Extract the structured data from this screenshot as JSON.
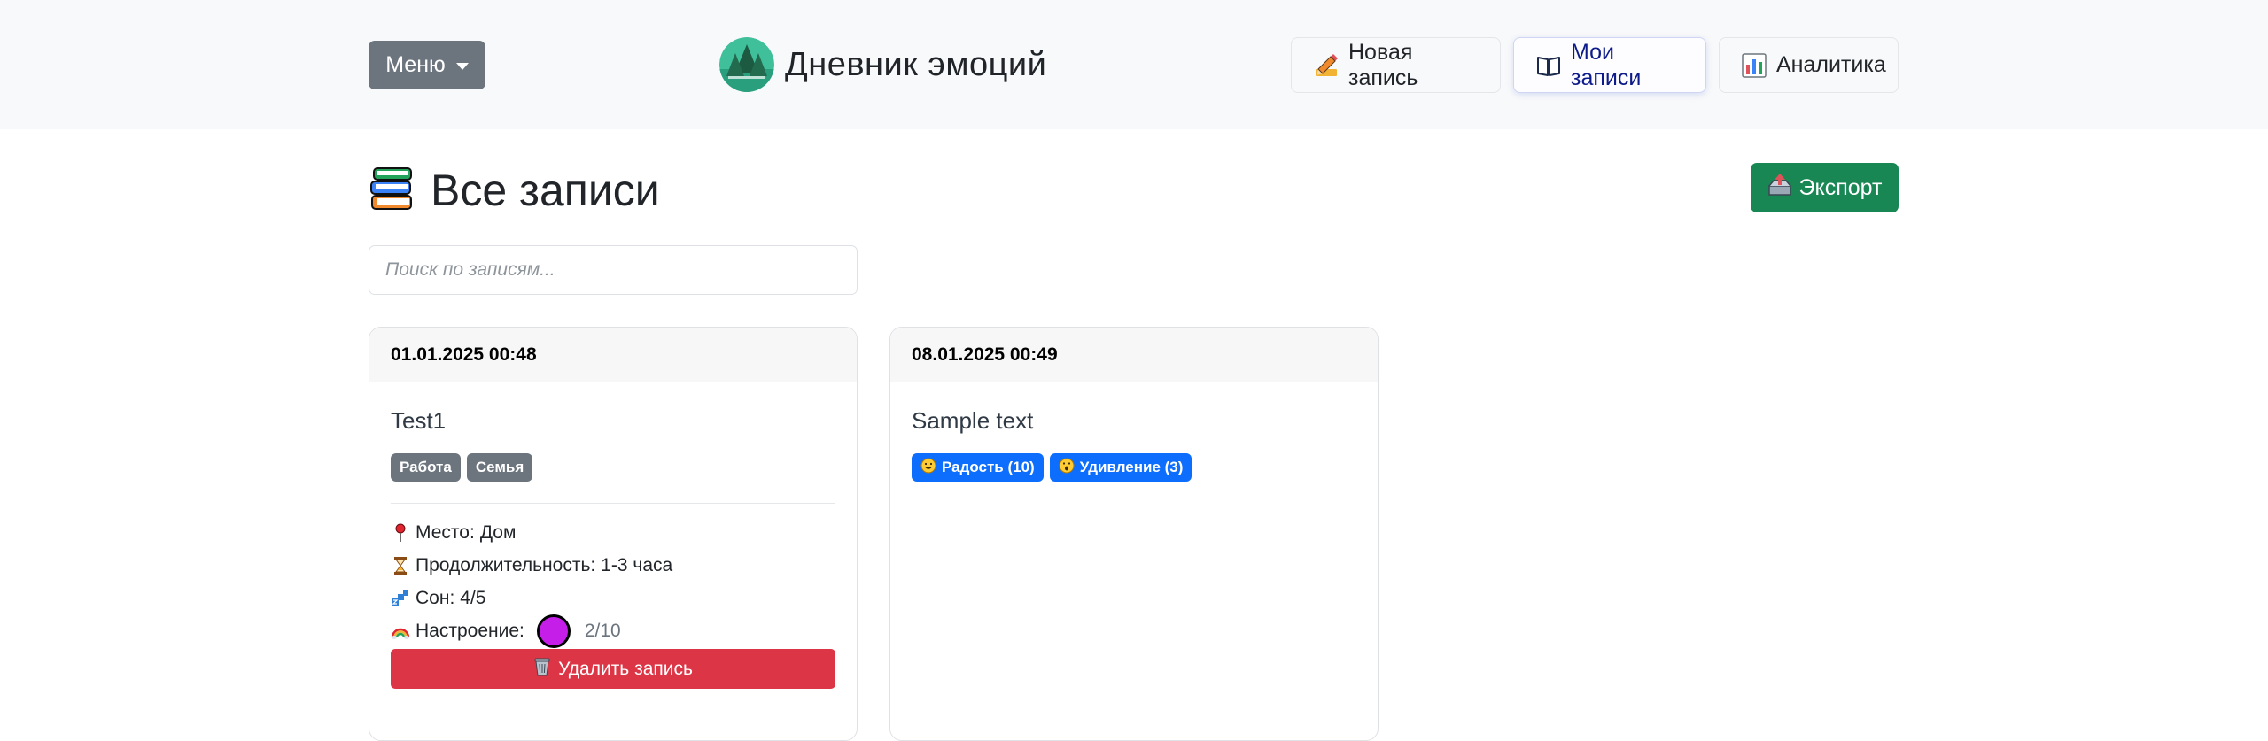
{
  "header": {
    "menu_label": "Меню",
    "brand_title": "Дневник эмоций",
    "nav": [
      {
        "label": "Новая запись",
        "icon": "pencil-icon"
      },
      {
        "label": "Мои записи",
        "icon": "book-icon",
        "active": true
      },
      {
        "label": "Аналитика",
        "icon": "bar-chart-icon"
      }
    ]
  },
  "page": {
    "title": "Все записи",
    "title_icon": "books-icon",
    "export_label": "Экспорт",
    "search_placeholder": "Поиск по записям..."
  },
  "entries": [
    {
      "datetime": "01.01.2025 00:48",
      "text": "Test1",
      "tags": [
        "Работа",
        "Семья"
      ],
      "details": {
        "place_label": "Место:",
        "place": "Дом",
        "duration_label": "Продолжительность:",
        "duration": "1-3 часа",
        "sleep_label": "Сон:",
        "sleep": "4/5",
        "mood_label": "Настроение:",
        "mood": "2/10",
        "mood_color": "#c51ee8"
      },
      "delete_label": "Удалить запись"
    },
    {
      "datetime": "08.01.2025 00:49",
      "text": "Sample text",
      "emotions": [
        {
          "label": "Радость (10)",
          "icon": "smile-emoji-icon"
        },
        {
          "label": "Удивление (3)",
          "icon": "surprised-emoji-icon"
        }
      ]
    }
  ],
  "colors": {
    "header_bg": "#f8f9fa",
    "menu_bg": "#6c757d",
    "export_bg": "#198754",
    "delete_bg": "#dc3545",
    "emotion_badge_bg": "#0d6efd",
    "tag_badge_bg": "#6c757d"
  }
}
